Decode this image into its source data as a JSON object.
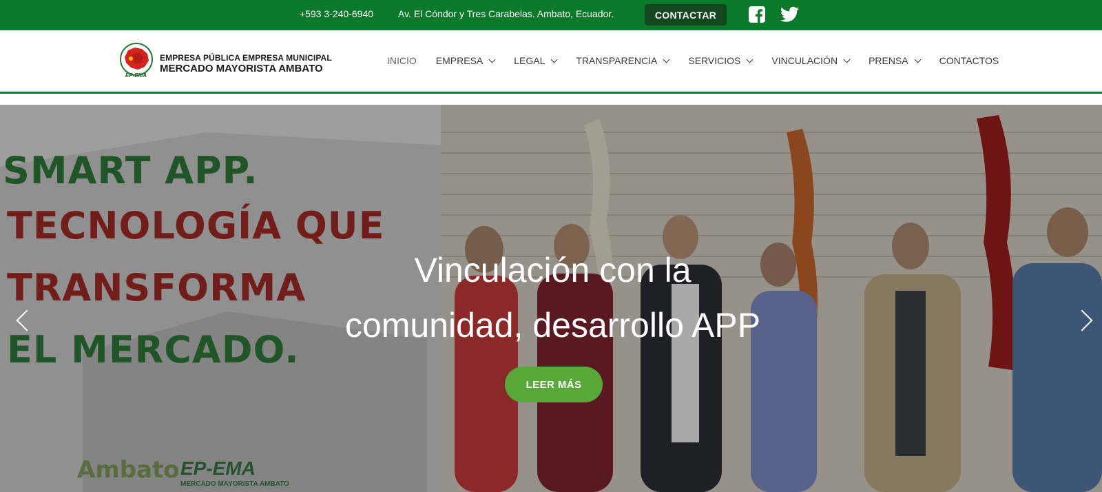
{
  "topbar": {
    "phone": "+593 3-240-6940",
    "address": "Av. El Cóndor y Tres Carabelas. Ambato, Ecuador.",
    "contact_button": "CONTACTAR",
    "icons": [
      "facebook-icon",
      "twitter-icon"
    ],
    "background": "#0a7a2a"
  },
  "header": {
    "logo_line1": "EMPRESA PÚBLICA EMPRESA MUNICIPAL",
    "logo_line2": "MERCADO MAYORISTA AMBATO",
    "logo_badge": "EP-EMA",
    "nav": [
      {
        "label": "INICIO",
        "dropdown": false,
        "active": true
      },
      {
        "label": "EMPRESA",
        "dropdown": true
      },
      {
        "label": "LEGAL",
        "dropdown": true
      },
      {
        "label": "TRANSPARENCIA",
        "dropdown": true
      },
      {
        "label": "SERVICIOS",
        "dropdown": true
      },
      {
        "label": "VINCULACIÓN",
        "dropdown": true
      },
      {
        "label": "PRENSA",
        "dropdown": true
      },
      {
        "label": "CONTACTOS",
        "dropdown": false
      }
    ]
  },
  "hero": {
    "poster_lines": [
      "SMART APP.",
      "TECNOLOGÍA QUE",
      "TRANSFORMA",
      "EL MERCADO."
    ],
    "title_line1": "Vinculación con la",
    "title_line2": "comunidad, desarrollo APP",
    "button": "LEER MÁS",
    "bottom_logo_ambato": "Ambato",
    "bottom_logo_epema": "EP-EMA",
    "bottom_logo_epema_sub": "MERCADO MAYORISTA AMBATO",
    "button_color": "#58a83a"
  }
}
